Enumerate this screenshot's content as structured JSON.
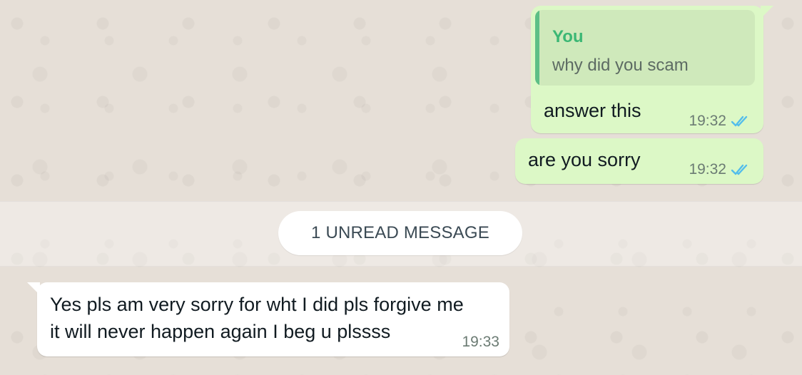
{
  "unread_separator": {
    "label": "1 UNREAD MESSAGE"
  },
  "messages": [
    {
      "direction": "outgoing",
      "quoted": {
        "author": "You",
        "text": "why did you scam"
      },
      "text": "answer this",
      "time": "19:32",
      "status": "read",
      "status_icon": "double-check-icon"
    },
    {
      "direction": "outgoing",
      "text": "are you sorry",
      "time": "19:32",
      "status": "read",
      "status_icon": "double-check-icon"
    },
    {
      "direction": "incoming",
      "lines": [
        "Yes pls am very sorry for wht I did pls forgive me",
        "it will never happen again I beg u plssss"
      ],
      "time": "19:33"
    }
  ],
  "colors": {
    "outgoing_bubble": "#dcf8c6",
    "incoming_bubble": "#ffffff",
    "quote_bar": "#5dbf86",
    "quote_author": "#3bb774",
    "read_ticks": "#53bdeb"
  }
}
